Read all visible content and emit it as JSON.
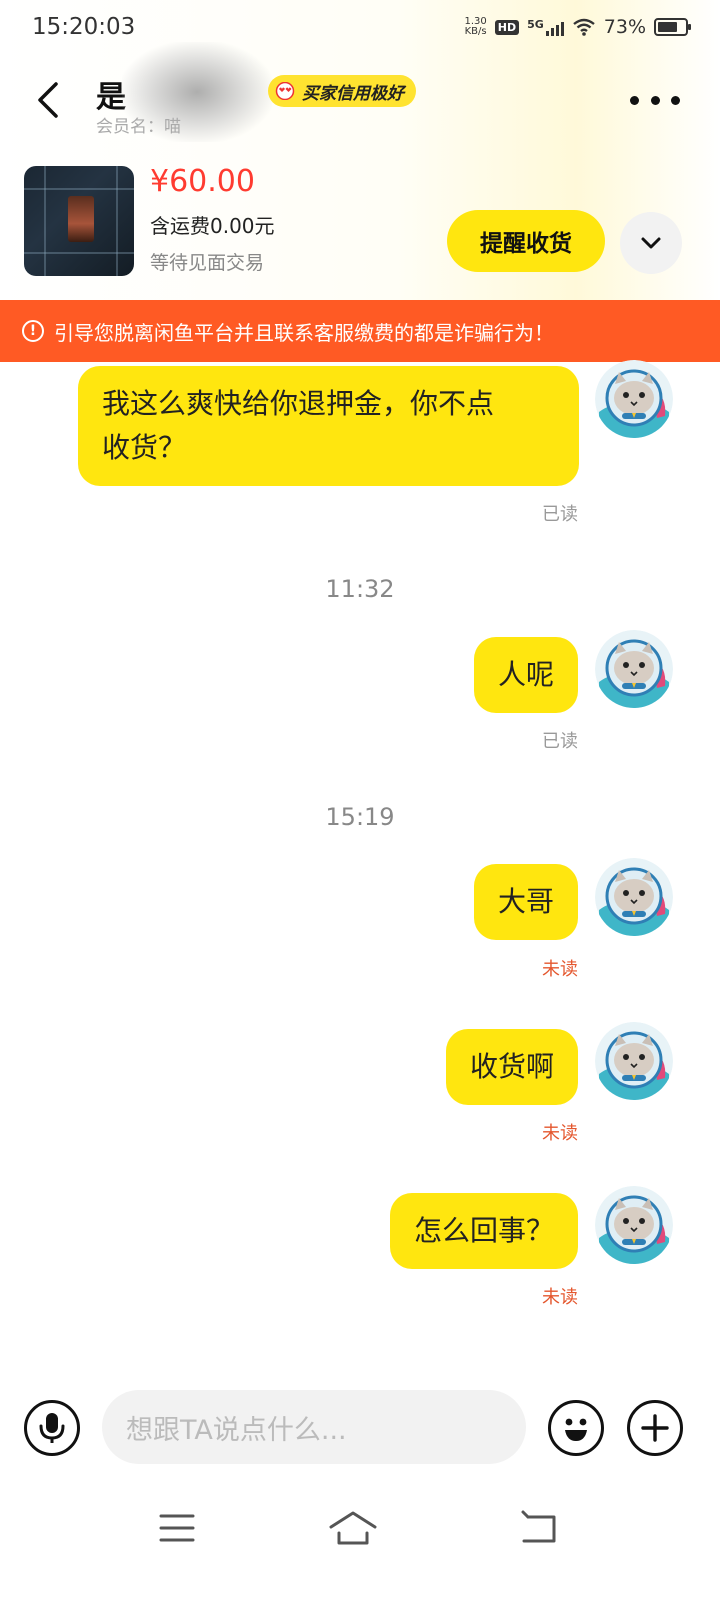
{
  "status_bar": {
    "time": "15:20:03",
    "net_speed_value": "1.30",
    "net_speed_unit": "KB/s",
    "hd": "HD",
    "network": "5G",
    "battery": "73%",
    "battery_level": 0.73
  },
  "header": {
    "title_visible": "是",
    "member_label": "会员名：喵",
    "credit_badge": "买家信用极好"
  },
  "product": {
    "price": "¥60.00",
    "shipping": "含运费0.00元",
    "trade_status": "等待见面交易",
    "remind_button": "提醒收货"
  },
  "warning": {
    "text": "引导您脱离闲鱼平台并且联系客服缴费的都是诈骗行为！"
  },
  "messages": [
    {
      "text_line1": "我这么爽快给你退押金，你不点",
      "text_line2": "收货？",
      "status": "已读"
    },
    {
      "time": "11:32"
    },
    {
      "text": "人呢",
      "status": "已读"
    },
    {
      "time": "15:19"
    },
    {
      "text": "大哥",
      "status": "未读"
    },
    {
      "text": "收货啊",
      "status": "未读"
    },
    {
      "text": "怎么回事？",
      "status": "未读"
    }
  ],
  "input_bar": {
    "placeholder": "想跟TA说点什么..."
  },
  "colors": {
    "accent_yellow": "#ffe60f",
    "warning_orange": "#ff5a24",
    "price_red": "#ff3b30",
    "unread_red": "#e4572e"
  },
  "icons": [
    "back-arrow-icon",
    "more-icon",
    "chevron-down-icon",
    "warning-icon",
    "microphone-icon",
    "emoji-icon",
    "plus-icon",
    "menu-icon",
    "home-icon",
    "return-icon"
  ]
}
